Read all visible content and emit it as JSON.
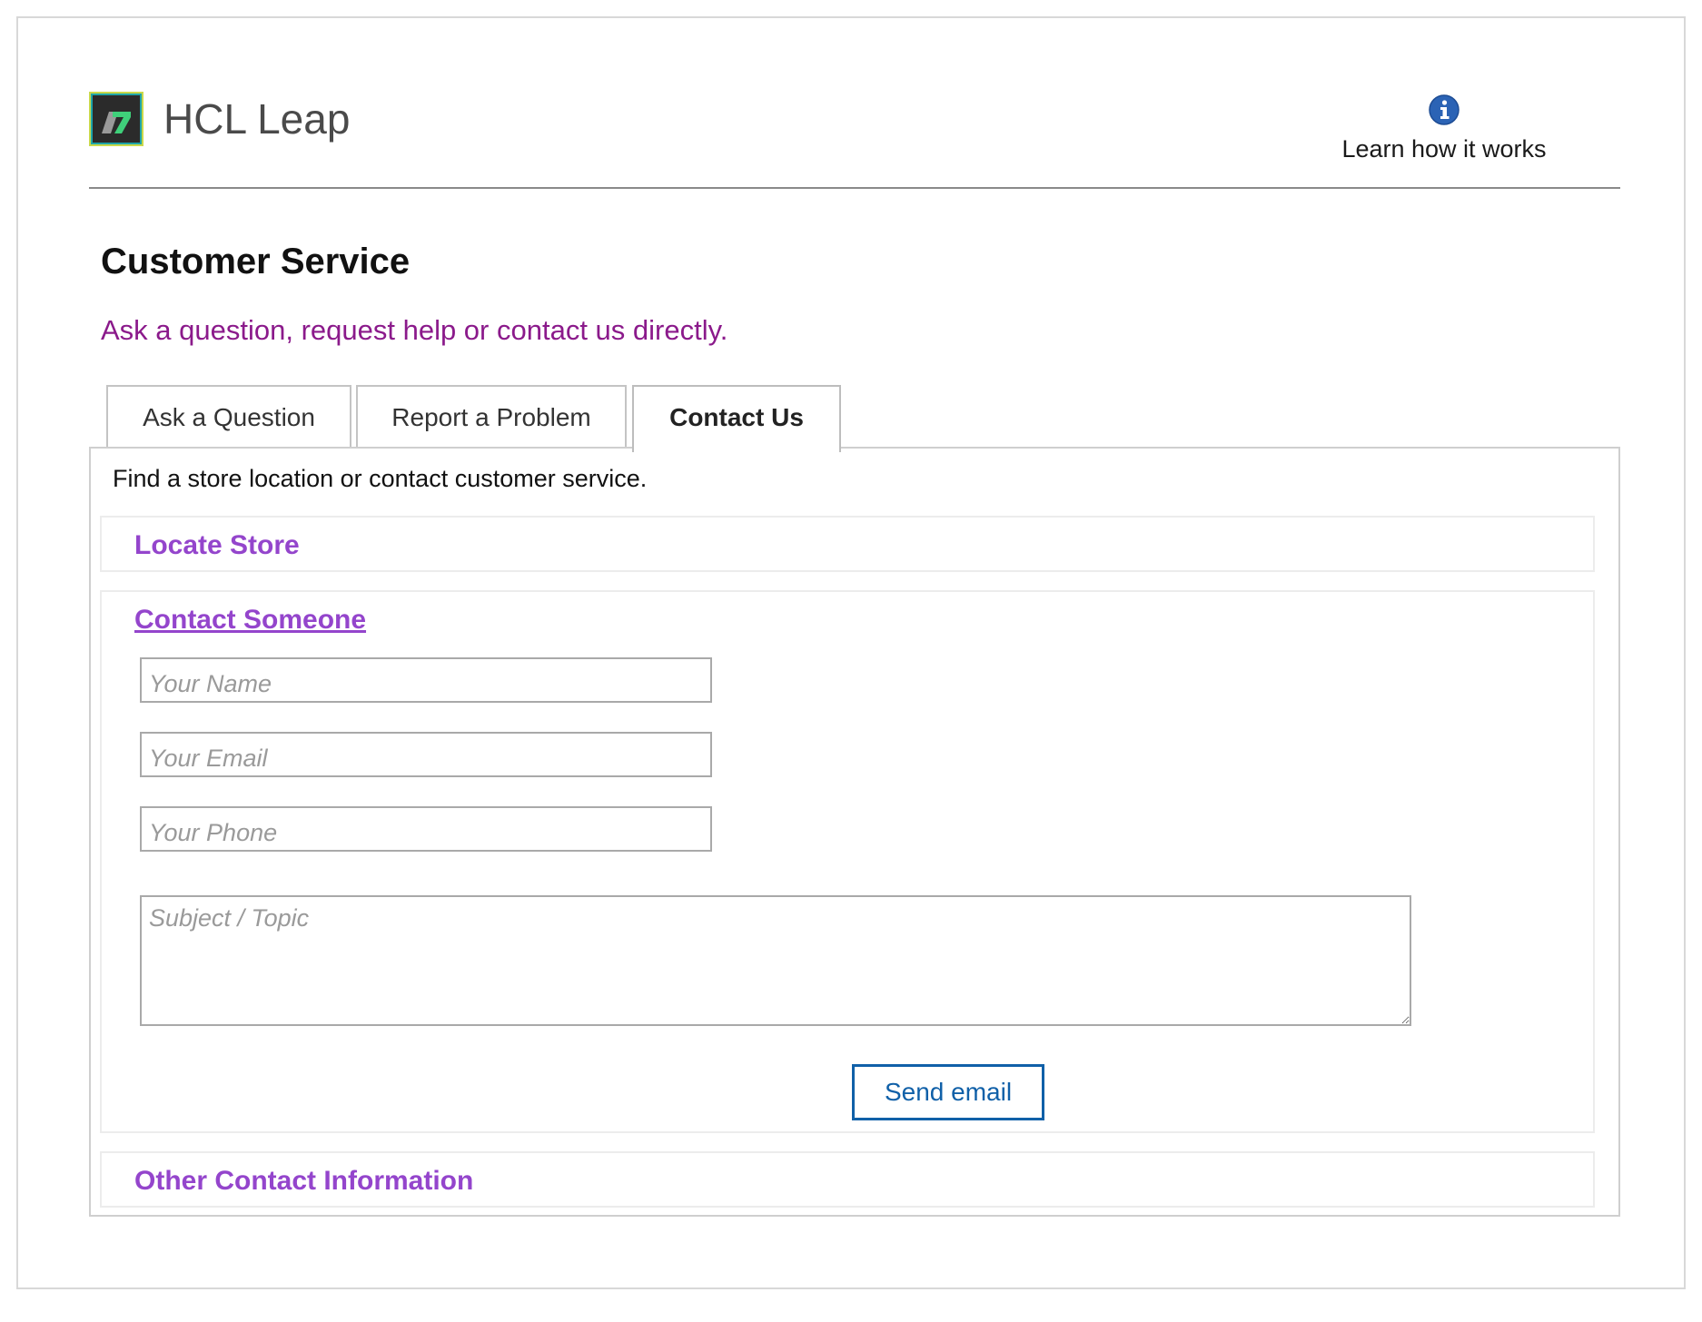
{
  "header": {
    "brand": "HCL Leap",
    "help_link": "Learn how it works",
    "help_icon": "info-icon",
    "logo_icon": "hcl-leap-logo-icon"
  },
  "page": {
    "title": "Customer Service",
    "subtitle": "Ask a question, request help or contact us directly."
  },
  "tabs": [
    {
      "label": "Ask a Question",
      "active": false
    },
    {
      "label": "Report a Problem",
      "active": false
    },
    {
      "label": "Contact Us",
      "active": true
    }
  ],
  "panel": {
    "description": "Find a store location or contact customer service.",
    "sections": {
      "locate": {
        "title": "Locate Store",
        "expanded": false
      },
      "contact": {
        "title": "Contact Someone",
        "expanded": true
      },
      "other": {
        "title": "Other Contact Information",
        "expanded": false
      }
    },
    "form": {
      "name": {
        "value": "",
        "placeholder": "Your Name"
      },
      "email": {
        "value": "",
        "placeholder": "Your Email"
      },
      "phone": {
        "value": "",
        "placeholder": "Your Phone"
      },
      "subject": {
        "value": "",
        "placeholder": "Subject / Topic"
      },
      "send_label": "Send email"
    }
  },
  "colors": {
    "subtitle": "#8b1a8b",
    "section_title": "#9445cc",
    "button_accent": "#1060a8",
    "info_icon": "#2b63b5"
  }
}
